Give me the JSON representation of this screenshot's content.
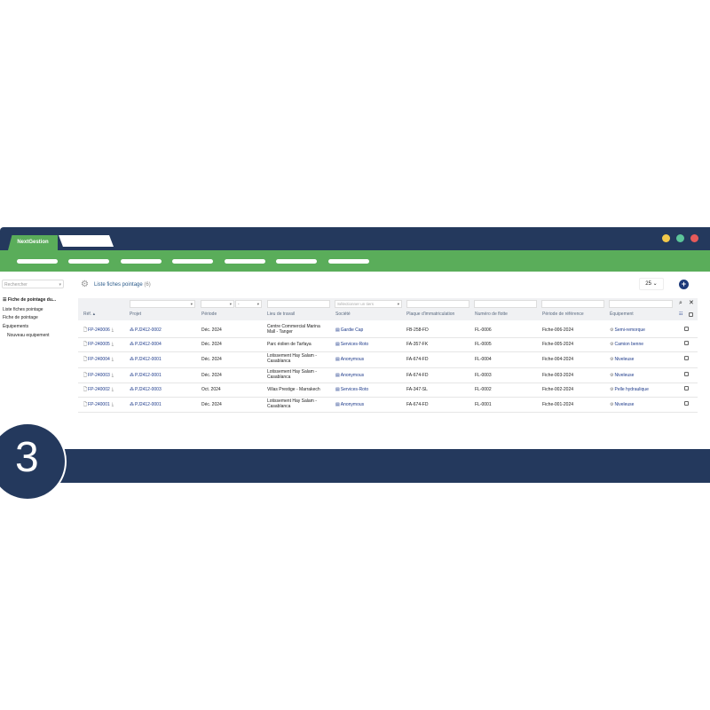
{
  "app": {
    "tab_label": "NextGestion"
  },
  "window_colors": {
    "frame": "#24395d",
    "green": "#5aad5a",
    "dot_yellow": "#f3c94a",
    "dot_green": "#5cc59a",
    "dot_red": "#e65a5a"
  },
  "sidebar": {
    "search_placeholder": "Rechercher",
    "items": [
      {
        "label": "Fiche de pointage du..."
      },
      {
        "label": "Liste fiches pointage"
      },
      {
        "label": "Fiche de pointage"
      },
      {
        "label": "Équipements"
      },
      {
        "label": "Nouveau equipement"
      }
    ]
  },
  "list": {
    "title": "Liste fiches pointage",
    "count": "(6)",
    "page_size": "25"
  },
  "filters": {
    "societe_placeholder": "Sélectionner un tiers",
    "dash": "-"
  },
  "columns": [
    "Réf.",
    "Projet",
    "Période",
    "Lieu de travail",
    "Société",
    "Plaque d'immatriculation",
    "Numéro de flotte",
    "Période de référence",
    "Équipement"
  ],
  "rows": [
    {
      "ref": "FP-240006",
      "projet": "PJ2412-0002",
      "periode": "Déc. 2024",
      "lieu1": "Centre Commercial Marina",
      "lieu2": "Mall - Tanger",
      "societe": "Gardie Cap",
      "plaque": "FB-258-FD",
      "flotte": "FL-0006",
      "ref_periode": "Fiche-006-2024",
      "equipement": "Semi-remorque"
    },
    {
      "ref": "FP-240005",
      "projet": "PJ2412-0004",
      "periode": "Déc. 2024",
      "lieu1": "Parc éolien de Tarfaya",
      "lieu2": "",
      "societe": "Services-Roto",
      "plaque": "FA-357-FK",
      "flotte": "FL-0005",
      "ref_periode": "Fiche-005-2024",
      "equipement": "Camion benne"
    },
    {
      "ref": "FP-240004",
      "projet": "PJ2412-0001",
      "periode": "Déc. 2024",
      "lieu1": "Lotissement Hay Salam -",
      "lieu2": "Casablanca",
      "societe": "Anonymous",
      "plaque": "FA-674-FD",
      "flotte": "FL-0004",
      "ref_periode": "Fiche-004-2024",
      "equipement": "Niveleuse"
    },
    {
      "ref": "FP-240003",
      "projet": "PJ2412-0001",
      "periode": "Déc. 2024",
      "lieu1": "Lotissement Hay Salam -",
      "lieu2": "Casablanca",
      "societe": "Anonymous",
      "plaque": "FA-674-FD",
      "flotte": "FL-0003",
      "ref_periode": "Fiche-003-2024",
      "equipement": "Niveleuse"
    },
    {
      "ref": "FP-240002",
      "projet": "PJ2412-0003",
      "periode": "Oct. 2024",
      "lieu1": "Villas Prestige - Marrakech",
      "lieu2": "",
      "societe": "Services-Roto",
      "plaque": "FA-347-SL",
      "flotte": "FL-0002",
      "ref_periode": "Fiche-002-2024",
      "equipement": "Pelle hydraulique"
    },
    {
      "ref": "FP-240001",
      "projet": "PJ2412-0001",
      "periode": "Déc. 2024",
      "lieu1": "Lotissement Hay Salam -",
      "lieu2": "Casablanca",
      "societe": "Anonymous",
      "plaque": "FA-674-FD",
      "flotte": "FL-0001",
      "ref_periode": "Fiche-001-2024",
      "equipement": "Niveleuse"
    }
  ],
  "badge": {
    "number": "3"
  }
}
